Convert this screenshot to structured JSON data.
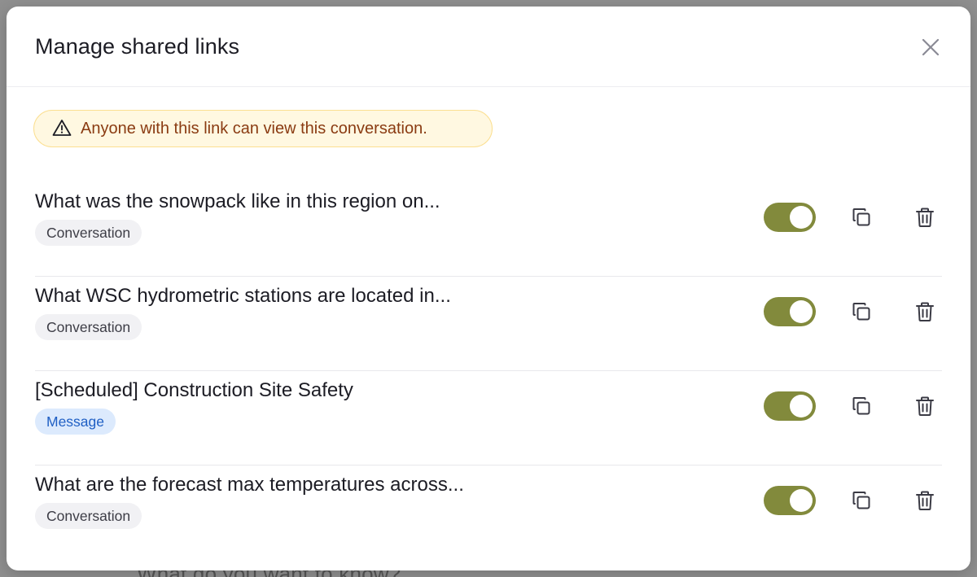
{
  "background": {
    "hint_text": "What do you want to know?"
  },
  "modal": {
    "title": "Manage shared links",
    "close_icon": "close-icon",
    "warning": {
      "icon": "warning-icon",
      "text": "Anyone with this link can view this conversation."
    },
    "links": [
      {
        "title": "What was the snowpack like in this region on...",
        "badge": "Conversation",
        "badge_type": "conversation",
        "enabled": true
      },
      {
        "title": "What WSC hydrometric stations are located in...",
        "badge": "Conversation",
        "badge_type": "conversation",
        "enabled": true
      },
      {
        "title": "[Scheduled] Construction Site Safety",
        "badge": "Message",
        "badge_type": "message",
        "enabled": true
      },
      {
        "title": "What are the forecast max temperatures across...",
        "badge": "Conversation",
        "badge_type": "conversation",
        "enabled": true
      }
    ]
  },
  "colors": {
    "toggle_on": "#828a3c",
    "warning_bg": "#fff8e1",
    "warning_border": "#fbdf91",
    "warning_text": "#8a3b12",
    "badge_message_bg": "#dceafd",
    "badge_message_text": "#1f5fc4"
  }
}
